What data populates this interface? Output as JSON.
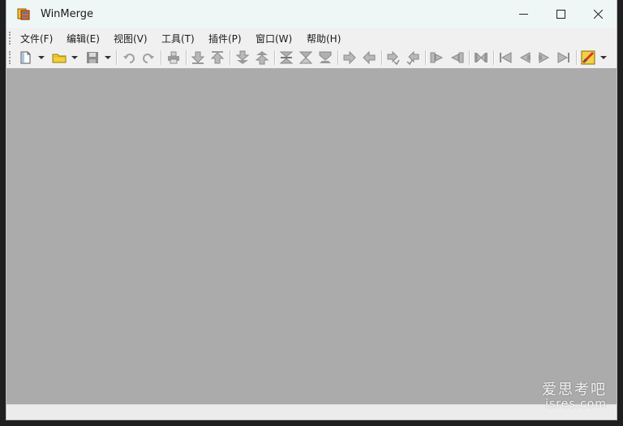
{
  "window": {
    "title": "WinMerge",
    "app_icon": "winmerge-logo-icon",
    "controls": [
      "minimize-icon",
      "maximize-icon",
      "close-icon"
    ]
  },
  "menu": {
    "items": [
      "文件(F)",
      "编辑(E)",
      "视图(V)",
      "工具(T)",
      "插件(P)",
      "窗口(W)",
      "帮助(H)"
    ]
  },
  "toolbar": {
    "buttons": [
      "new-document-icon",
      "open-folder-icon",
      "save-icon",
      "undo-icon",
      "redo-icon",
      "print-icon",
      "next-difference-icon",
      "previous-difference-icon",
      "last-difference-icon",
      "first-difference-icon",
      "current-difference-icon",
      "next-conflict-icon",
      "previous-conflict-icon",
      "copy-right-icon",
      "copy-left-icon",
      "copy-right-advance-icon",
      "copy-left-advance-icon",
      "copy-all-right-icon",
      "copy-all-left-icon",
      "merge-icon",
      "first-file-icon",
      "previous-file-icon",
      "next-file-icon",
      "last-file-icon",
      "options-icon"
    ]
  },
  "watermark": {
    "line1": "爱思考吧",
    "line2": "isres.com"
  },
  "colors": {
    "titlebar": "#eef6f6",
    "client": "#ababab",
    "chrome": "#f0f0f0"
  }
}
